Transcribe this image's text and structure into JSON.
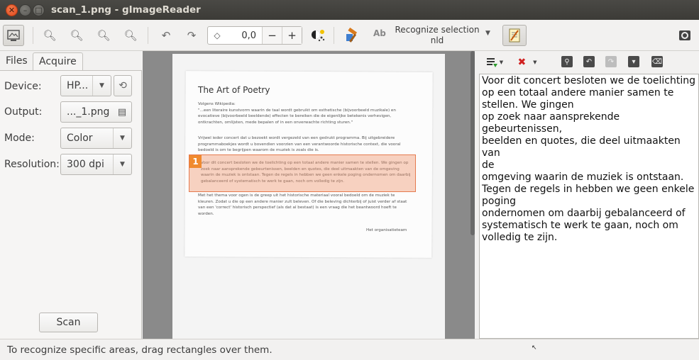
{
  "window": {
    "title": "scan_1.png - gImageReader"
  },
  "toolbar": {
    "rotation_value": "0,0",
    "minus": "−",
    "plus": "+",
    "recognize_label": "Recognize selection",
    "recognize_lang": "nld",
    "ab_glyph": "Ab"
  },
  "left": {
    "tabs": [
      "Files",
      "Acquire"
    ],
    "device_label": "Device:",
    "device_value": "HP...",
    "output_label": "Output:",
    "output_value": "..._1.png",
    "mode_label": "Mode:",
    "mode_value": "Color",
    "resolution_label": "Resolution:",
    "resolution_value": "300 dpi",
    "scan_button": "Scan"
  },
  "document": {
    "title": "The Art of Poetry",
    "p1": "Volgens Wikipedia:\n\"...een literaire kunstvorm waarin de taal wordt gebruikt om esthetische (bijvoorbeeld muzikale) en evocatieve (bijvoorbeeld beeldende) effecten te bereiken die de eigenlijke betekenis verhevigen, ontkrachten, omlijsten, mede bepalen of in een onverwachte richting sturen.\"",
    "p2": "Vrijwel ieder concert dat u bezoekt wordt vergezeld van een gedrukt programma. Bij uitgebreidere programmaboekjes wordt u bovendien voorzien van een verantwoorde historische context, die vooral bedoeld is om te begrijpen waarom de muziek is zoals die is.",
    "p3": "Voor dit concert besloten we de toelichting op een totaal andere manier samen te stellen. We gingen op zoek naar aansprekende gebeurtenissen, beelden en quotes, die deel uitmaakten van de omgeving waarin de muziek is ontstaan. Tegen de regels in hebben we geen enkele poging ondernomen om daarbij gebalanceerd of systematisch te werk te gaan, noch om volledig te zijn.",
    "p4": "Met het thema voor ogen is de greep uit het historische materiaal vooral bedoeld om de muziek te kleuren. Zodat u die op een andere manier zult beleven. Of die beleving dichterbij of juist verder af staat van een 'correct' historisch perspectief (als dat al bestaat) is een vraag die het beantwoord hoeft te worden.",
    "signature": "Het organisatieteam",
    "selection_number": "1"
  },
  "output_text": "Voor dit concert besloten we de toelichting\nop een totaal andere manier samen te\nstellen. We gingen\nop zoek naar aansprekende gebeurtenissen,\nbeelden en quotes, die deel uitmaakten van\nde\nomgeving waarin de muziek is ontstaan.\nTegen de regels in hebben we geen enkele\npoging\nondernomen om daarbij gebalanceerd of\nsystematisch te werk te gaan, noch om\nvolledig te zijn.",
  "status": {
    "message": "To recognize specific areas, drag rectangles over them."
  }
}
